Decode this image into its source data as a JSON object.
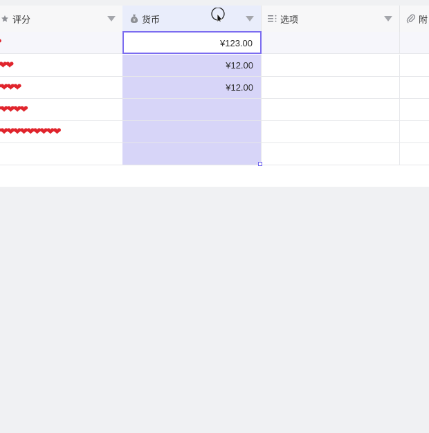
{
  "columns": {
    "rating": {
      "label": "评分",
      "icon": "rating-icon"
    },
    "currency": {
      "label": "货币",
      "icon": "money-bag-icon"
    },
    "options": {
      "label": "选项",
      "icon": "list-options-icon"
    },
    "attachment": {
      "label": "附",
      "icon": "paperclip-icon"
    }
  },
  "rows": [
    {
      "rating_hearts": "❤",
      "currency": "¥123.00"
    },
    {
      "rating_hearts": "❤❤",
      "currency": "¥12.00"
    },
    {
      "rating_hearts": "❤❤❤❤",
      "currency": "¥12.00"
    },
    {
      "rating_hearts": "❤❤❤❤❤",
      "currency": ""
    },
    {
      "rating_hearts": "❤❤❤❤❤❤❤❤❤❤",
      "currency": ""
    },
    {
      "rating_hearts": "",
      "currency": ""
    }
  ],
  "colors": {
    "selection_fill": "#d7d5f8",
    "active_border": "#7b6cf0",
    "heart": "#e0242c"
  }
}
